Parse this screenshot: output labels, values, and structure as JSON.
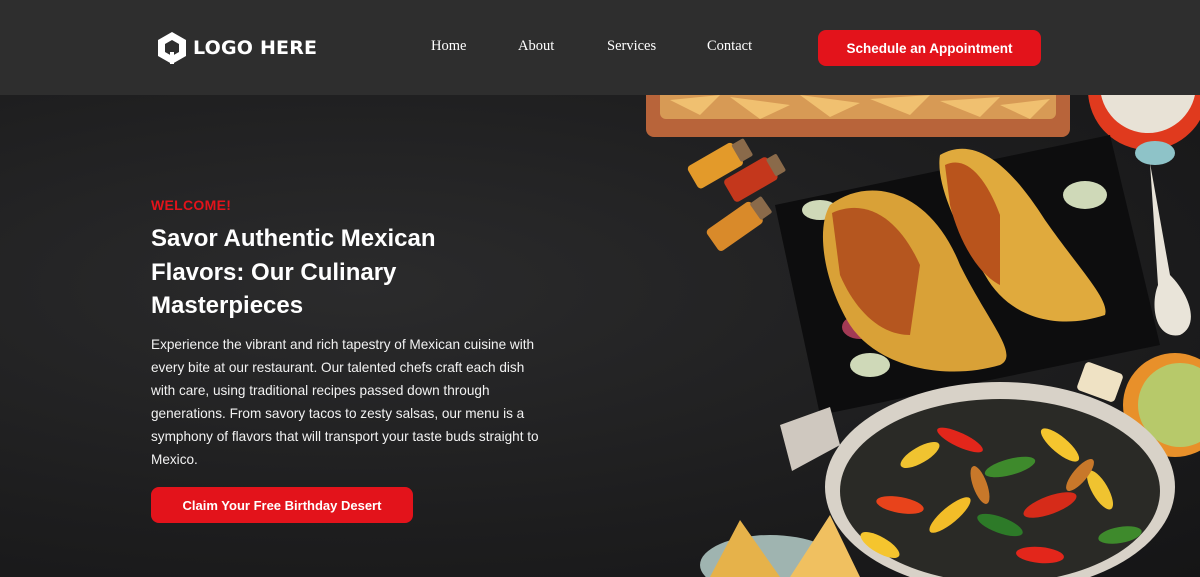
{
  "header": {
    "logo_text": "LOGO HERE",
    "logo_icon": "hexagon-logo-icon",
    "nav": [
      {
        "label": "Home"
      },
      {
        "label": "About"
      },
      {
        "label": "Services"
      },
      {
        "label": "Contact"
      }
    ],
    "cta_label": "Schedule an Appointment"
  },
  "hero": {
    "eyebrow": "WELCOME!",
    "title": "Savor Authentic Mexican Flavors: Our Culinary Masterpieces",
    "description": "Experience the vibrant and rich tapestry of Mexican cuisine with every bite at our restaurant. Our talented chefs craft each dish with care, using traditional recipes passed down through generations. From savory tacos to zesty salsas, our menu is a symphony of flavors that will transport your taste buds straight to Mexico.",
    "cta_label": "Claim Your Free Birthday Desert"
  },
  "colors": {
    "accent": "#e3131b",
    "header_bg": "#2e2e2e",
    "hero_bg": "#1d1d1e"
  }
}
